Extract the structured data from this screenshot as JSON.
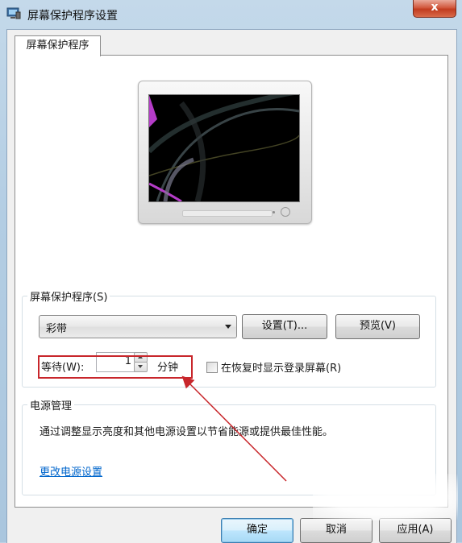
{
  "window": {
    "title": "屏幕保护程序设置",
    "close_glyph": "x"
  },
  "tabs": [
    {
      "label": "屏幕保护程序"
    }
  ],
  "screensaver": {
    "group_label": "屏幕保护程序(S)",
    "selected": "彩带",
    "settings_button": "设置(T)...",
    "preview_button": "预览(V)",
    "wait_label": "等待(W):",
    "wait_value": "1",
    "minutes_label": "分钟",
    "resume_checkbox_label": "在恢复时显示登录屏幕(R)",
    "resume_checked": false
  },
  "power": {
    "group_label": "电源管理",
    "description": "通过调整显示亮度和其他电源设置以节省能源或提供最佳性能。",
    "link": "更改电源设置"
  },
  "buttons": {
    "ok": "确定",
    "cancel": "取消",
    "apply": "应用(A)"
  },
  "colors": {
    "annotation": "#c8262b",
    "link": "#0066cc"
  },
  "icons": {
    "app": "display-properties-icon",
    "close": "close-icon",
    "dropdown": "chevron-down-icon"
  }
}
